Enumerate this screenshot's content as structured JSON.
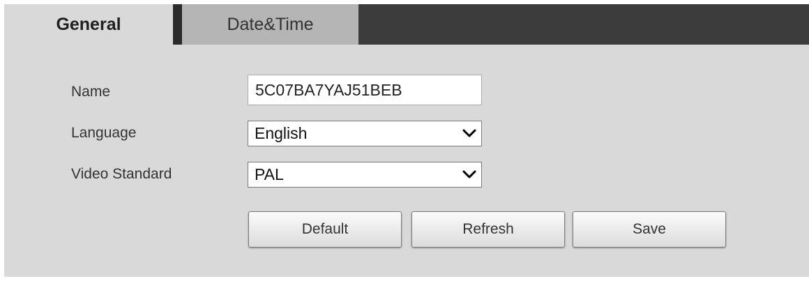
{
  "tabs": [
    {
      "label": "General",
      "active": true
    },
    {
      "label": "Date&Time",
      "active": false
    }
  ],
  "form": {
    "name": {
      "label": "Name",
      "value": "5C07BA7YAJ51BEB"
    },
    "language": {
      "label": "Language",
      "value": "English",
      "icon": "chevron-down-icon"
    },
    "video_standard": {
      "label": "Video Standard",
      "value": "PAL",
      "icon": "chevron-down-icon"
    }
  },
  "buttons": {
    "default": "Default",
    "refresh": "Refresh",
    "save": "Save"
  },
  "colors": {
    "panel_bg": "#d9d9d9",
    "tabbar_bg": "#3c3c3c",
    "inactive_tab_bg": "#b5b5b5"
  }
}
